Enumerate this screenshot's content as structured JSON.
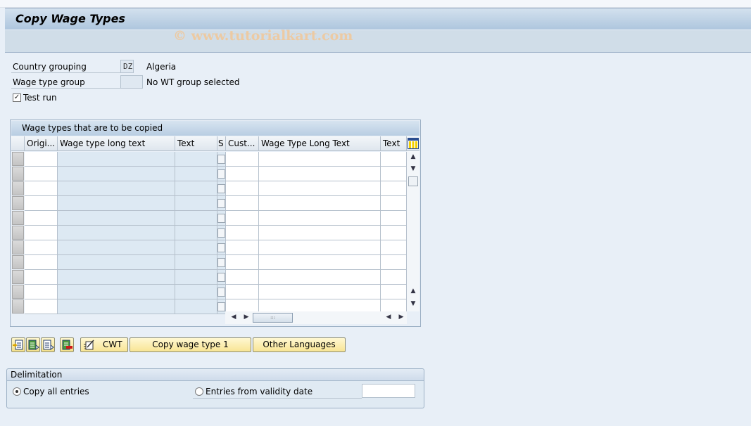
{
  "window": {
    "title": "Copy Wage Types",
    "watermark": "© www.tutorialkart.com"
  },
  "selection": {
    "country_grouping": {
      "label": "Country grouping",
      "value": "DZ",
      "description": "Algeria"
    },
    "wage_type_group": {
      "label": "Wage type group",
      "value": "",
      "description": "No WT group selected"
    },
    "test_run": {
      "label": "Test run",
      "checked": true,
      "mark": "✓"
    }
  },
  "table": {
    "title": "Wage types that are to be copied",
    "columns": [
      {
        "key": "orig",
        "label": "Origi..."
      },
      {
        "key": "wt_long_text",
        "label": "Wage type long text"
      },
      {
        "key": "text",
        "label": "Text"
      },
      {
        "key": "s",
        "label": "S"
      },
      {
        "key": "cust",
        "label": "Cust..."
      },
      {
        "key": "wt_long_text2",
        "label": "Wage Type Long Text"
      },
      {
        "key": "text2",
        "label": "Text"
      }
    ],
    "row_count": 11,
    "rows": [],
    "icons": {
      "column_config": "column-settings-icon",
      "scroll_up": "▲",
      "scroll_down": "▼",
      "scroll_left": "◀",
      "scroll_right": "▶",
      "thumb_grip": ":::"
    }
  },
  "buttons": {
    "icon_buttons": [
      "insert-row-icon",
      "select-all-icon",
      "select-block-icon",
      "delete-row-icon"
    ],
    "cwt": "CWT",
    "copy_wage_type": "Copy wage type 1",
    "other_languages": "Other Languages"
  },
  "delimitation": {
    "title": "Delimitation",
    "options": [
      {
        "label": "Copy all entries",
        "selected": true
      },
      {
        "label": "Entries from validity date",
        "selected": false
      }
    ],
    "validity_date": ""
  }
}
